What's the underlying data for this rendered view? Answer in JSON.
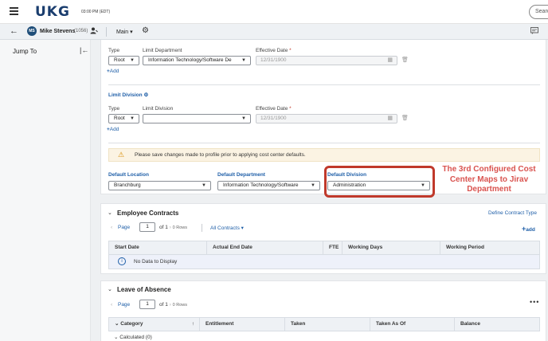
{
  "topbar": {
    "brand": "UKG",
    "time": "03:00 PM (EDT)",
    "search_placeholder": "Search",
    "menu_icon": "hamburger-icon"
  },
  "navbar": {
    "avatar_initials": "MS",
    "employee_name": "Mike Stevens",
    "employee_id": "(1056)",
    "menu_label": "Main",
    "icons": [
      "back-arrow-icon",
      "person-edit-icon",
      "gear-icon",
      "message-icon"
    ]
  },
  "left_panel": {
    "jump_to": "Jump To"
  },
  "limit_department": {
    "type_label": "Type",
    "limit_label": "Limit Department",
    "date_label": "Effective Date",
    "type_value": "Root",
    "limit_value": "Information Technology/Software De",
    "date_value": "12/31/1900",
    "add_label": "Add"
  },
  "limit_division": {
    "title": "Limit Division",
    "type_label": "Type",
    "limit_label": "Limit Division",
    "date_label": "Effective Date",
    "type_value": "Root",
    "limit_value": "",
    "date_value": "12/31/1900",
    "add_label": "Add"
  },
  "warning": {
    "text": "Please save changes made to profile prior to applying cost center defaults."
  },
  "defaults": {
    "location_label": "Default Location",
    "location_value": "Branchburg",
    "department_label": "Default Department",
    "department_value": "Information Technology/Software",
    "division_label": "Default Division",
    "division_value": "Administration"
  },
  "annotation": {
    "text": "The 3rd Configured Cost Center Maps to Jirav Department",
    "color": "#d9534f"
  },
  "contracts": {
    "title": "Employee Contracts",
    "define_link": "Define Contract Type",
    "page_label": "Page",
    "page_value": "1",
    "of_label": "of 1",
    "rows_label": "0 Rows",
    "filter": "All Contracts",
    "add_label": "add",
    "columns": [
      "Start Date",
      "Actual End Date",
      "FTE",
      "Working Days",
      "Working Period"
    ],
    "no_data": "No Data to Display"
  },
  "leave": {
    "title": "Leave of Absence",
    "page_label": "Page",
    "page_value": "1",
    "of_label": "of 1",
    "rows_label": "0 Rows",
    "columns": [
      "Category",
      "Entitlement",
      "Taken",
      "Taken As Of",
      "Balance"
    ],
    "group_row": "Calculated (0)"
  }
}
